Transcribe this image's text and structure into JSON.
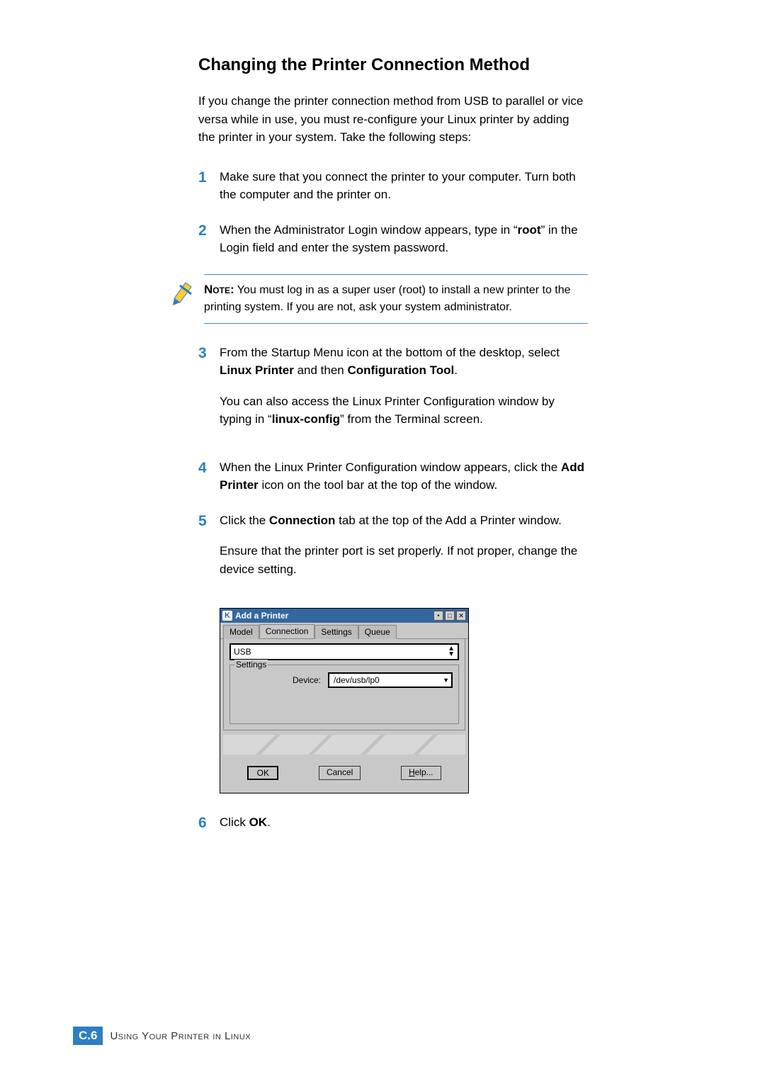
{
  "title": "Changing the Printer Connection Method",
  "intro": "If you change the printer connection method from USB to parallel or vice versa while in use, you must re-configure your Linux printer by adding the printer in your system. Take the following steps:",
  "steps": {
    "s1": {
      "num": "1",
      "text": "Make sure that you connect the printer to your computer. Turn both the computer and the printer on."
    },
    "s2": {
      "num": "2",
      "pre": "When the Administrator Login window appears, type in “",
      "bold": "root",
      "post": "” in the Login field and enter the system password."
    },
    "s3": {
      "num": "3",
      "p1_pre": "From the Startup Menu icon at the bottom of the desktop, select ",
      "p1_b1": "Linux Printer",
      "p1_mid": " and then ",
      "p1_b2": "Configuration Tool",
      "p1_post": ".",
      "p2_pre": "You can also access the Linux Printer Configuration window by typing in “",
      "p2_b": "linux-config",
      "p2_post": "” from the Terminal screen."
    },
    "s4": {
      "num": "4",
      "pre": "When the Linux Printer Configuration window appears, click the ",
      "bold": "Add Printer",
      "post": " icon on the tool bar at the top of the window."
    },
    "s5": {
      "num": "5",
      "p1_pre": "Click the ",
      "p1_b": "Connection",
      "p1_post": " tab at the top of the Add a Printer window.",
      "p2": "Ensure that the printer port is set properly. If not proper, change the device setting."
    },
    "s6": {
      "num": "6",
      "pre": "Click ",
      "bold": "OK",
      "post": "."
    }
  },
  "note": {
    "label": "Note:",
    "text": " You must log in as a super user (root) to install a new printer to the printing system. If you are not, ask your system administrator."
  },
  "dialog": {
    "k": "K",
    "title": "Add a Printer",
    "btn_min": "•",
    "btn_max": "□",
    "btn_close": "✕",
    "tabs": {
      "model": "Model",
      "connection": "Connection",
      "settings": "Settings",
      "queue": "Queue"
    },
    "combo_value": "USB",
    "fieldset_label": "Settings",
    "device_label": "Device:",
    "device_value": "/dev/usb/lp0",
    "ok": "OK",
    "cancel": "Cancel",
    "help_h": "H",
    "help_rest": "elp..."
  },
  "footer": {
    "badge_left": "C.",
    "badge_num": "6",
    "text": "Using Your Printer in Linux"
  }
}
